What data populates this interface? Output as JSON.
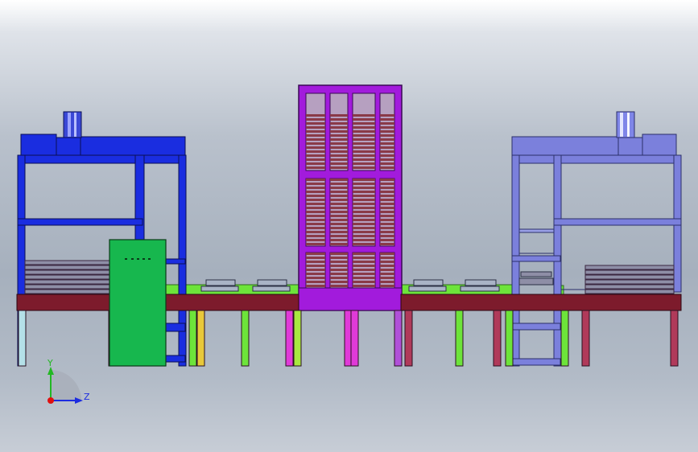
{
  "axis_triad": {
    "y_label": "Y",
    "z_label": "Z"
  },
  "colors": {
    "left_frame": "#1a2de0",
    "right_frame": "#7b80dc",
    "tower": "#a21bdc",
    "tower_shelf": "#8a3a48",
    "control_cabinet": "#17b74e",
    "conveyor_rail": "#7d1b2c",
    "green_belt": "#6de43a",
    "y_axis": "#22b822",
    "z_axis": "#1c2ce0",
    "origin": "#e01010"
  }
}
